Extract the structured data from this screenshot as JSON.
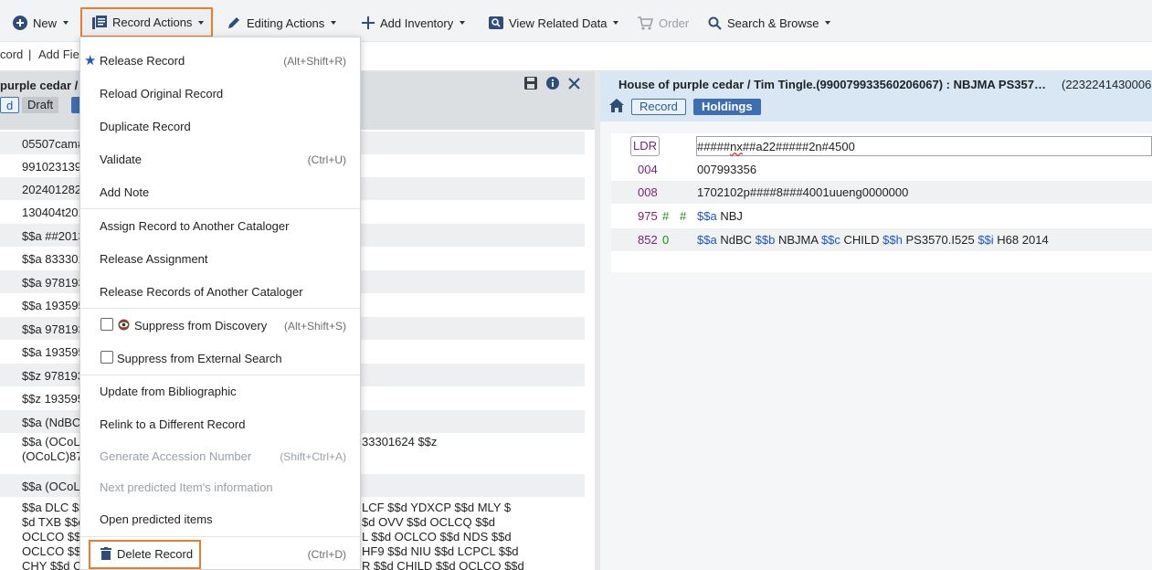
{
  "toolbar": {
    "new": "New",
    "record_actions": "Record Actions",
    "editing_actions": "Editing Actions",
    "add_inventory": "Add Inventory",
    "view_related_data": "View Related Data",
    "order": "Order",
    "search_browse": "Search & Browse"
  },
  "subbar": {
    "record": "cord",
    "separator": "|",
    "add_field": "Add Fie"
  },
  "left": {
    "title": "purple cedar / T",
    "chip_1": "d",
    "chip_draft": "Draft",
    "rows": [
      "05507cam#",
      "991023139",
      "202401282",
      "130404t201",
      "$$a ##2013",
      "$$a 833301",
      "$$a 978193",
      "$$a 193595",
      "$$a 978193",
      "$$a 193595",
      "$$z 978193",
      "$$z 193595",
      "$$a (NdBC",
      "$$a (OCoLC",
      "(OCoLC)87",
      "$$a (OCoL",
      "$$a DLC $$",
      "$d TXB $$c",
      "OCLCO $$",
      "OCLCO $$",
      "CHY $$d C"
    ],
    "row_tails": {
      "oclc": "33301624 $$z",
      "r1": "LCF $$d YDXCP $$d MLY $",
      "r2": "$d OVV $$d OCLCQ $$d",
      "r3": "L $$d OCLCO $$d NDS $$d",
      "r4": "HF9 $$d NIU $$d LCPCL $$d",
      "r5": "R $$d CHILD $$d OCLCQ $$d"
    }
  },
  "right": {
    "title": "House of purple cedar / Tim Tingle.(990079933560206067) : NBJMA PS357…",
    "id": "(2232241430006",
    "tab_record": "Record",
    "tab_holdings": "Holdings",
    "ldr_tag": "LDR",
    "ldr_value_a": "#####",
    "ldr_value_b": "nx",
    "ldr_value_c": "##a22#####2n#4500",
    "fields": [
      {
        "tag": "004",
        "ind1": "",
        "ind2": "",
        "value": "007993356"
      },
      {
        "tag": "008",
        "ind1": "",
        "ind2": "",
        "value": "1702102p####8###4001uueng0000000"
      },
      {
        "tag": "975",
        "ind1": "#",
        "ind2": "#"
      },
      {
        "tag": "852",
        "ind1": "0",
        "ind2": ""
      }
    ],
    "f975": {
      "sa": "$$a",
      "a": "NBJ"
    },
    "f852": {
      "sa": "$$a",
      "a": "NdBC",
      "sb": "$$b",
      "b": "NBJMA",
      "sc": "$$c",
      "c": "CHILD",
      "sh": "$$h",
      "h": "PS3570.I525",
      "si": "$$i",
      "i": "H68 2014"
    }
  },
  "menu": {
    "items": [
      {
        "label": "Release Record",
        "shortcut": "(Alt+Shift+R)"
      },
      {
        "label": "Reload Original Record",
        "shortcut": ""
      },
      {
        "label": "Duplicate Record",
        "shortcut": ""
      },
      {
        "label": "Validate",
        "shortcut": "(Ctrl+U)"
      },
      {
        "label": "Add Note",
        "shortcut": ""
      },
      {
        "label": "Assign Record to Another Cataloger",
        "shortcut": ""
      },
      {
        "label": "Release Assignment",
        "shortcut": ""
      },
      {
        "label": "Release Records of Another Cataloger",
        "shortcut": ""
      },
      {
        "label": "Suppress from Discovery",
        "shortcut": "(Alt+Shift+S)"
      },
      {
        "label": "Suppress from External Search",
        "shortcut": ""
      },
      {
        "label": "Update from Bibliographic",
        "shortcut": ""
      },
      {
        "label": "Relink to a Different Record",
        "shortcut": ""
      },
      {
        "label": "Generate Accession Number",
        "shortcut": "(Shift+Ctrl+A)"
      },
      {
        "label": "Next predicted Item's information",
        "shortcut": ""
      },
      {
        "label": "Open predicted items",
        "shortcut": ""
      },
      {
        "label": "Delete Record",
        "shortcut": "(Ctrl+D)"
      }
    ]
  },
  "colors": {
    "highlight": "#e87d2b",
    "accent": "#3f6eb0",
    "tag": "#7a1f7a",
    "subfield": "#1f56c0"
  }
}
